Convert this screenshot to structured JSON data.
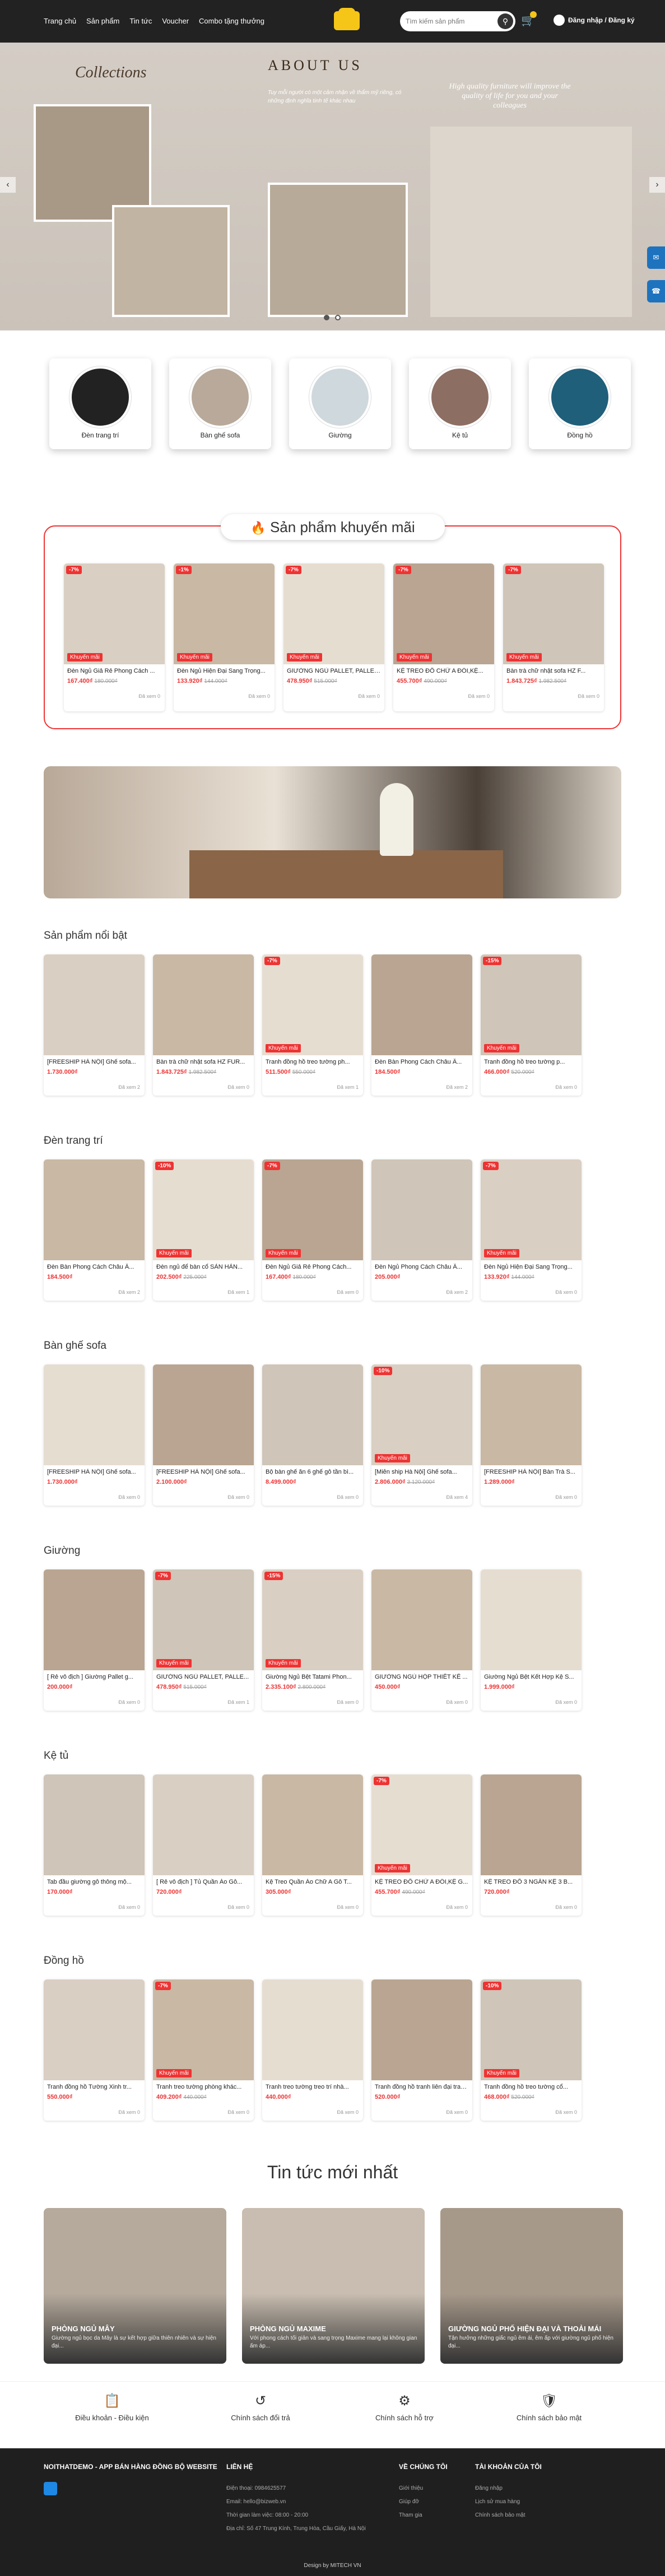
{
  "nav": [
    "Trang chủ",
    "Sản phẩm",
    "Tin tức",
    "Voucher",
    "Combo tặng thưởng"
  ],
  "search": {
    "placeholder": "Tìm kiếm sản phẩm"
  },
  "login": "Đăng nhập / Đăng ký",
  "hero": {
    "collections": "Collections",
    "about": "ABOUT US",
    "about_text": "Tuy mỗi người có một cảm nhận về thẩm mỹ riêng, có những định nghĩa tinh tế khác nhau",
    "quote": "High quality furniture will improve the quality of life for you and your colleagues"
  },
  "categories": [
    "Đèn trang trí",
    "Bàn ghế sofa",
    "Giường",
    "Kệ tủ",
    "Đồng hồ"
  ],
  "promo_title": "Sản phẩm khuyến mãi",
  "promo": [
    {
      "d": "-7%",
      "n": "Đèn Ngủ Giả Rẻ Phong Cách ...",
      "p": "167.400₫",
      "o": "180.000₫",
      "s": "Đã xem 0"
    },
    {
      "d": "-1%",
      "n": "Đèn Ngủ Hiện Đại Sang Trọng...",
      "p": "133.920₫",
      "o": "144.000₫",
      "s": "Đã xem 0"
    },
    {
      "d": "-7%",
      "n": "GIƯỜNG NGỦ PALLET, PALLET...",
      "p": "478.950₫",
      "o": "515.000₫",
      "s": "Đã xem 0"
    },
    {
      "d": "-7%",
      "n": "KỆ TREO ĐỒ CHỮ A ĐÔI,KỆ...",
      "p": "455.700₫",
      "o": "490.000₫",
      "s": "Đã xem 0"
    },
    {
      "d": "-7%",
      "n": "Bàn trà chữ nhật sofa HZ F...",
      "p": "1.843.725₫",
      "o": "1.982.500₫",
      "s": "Đã xem 0"
    }
  ],
  "sections": [
    {
      "title": "Sản phẩm nổi bật",
      "items": [
        {
          "d": "",
          "n": "[FREESHIP HÀ NỘI] Ghế sofa...",
          "p": "1.730.000₫",
          "o": "",
          "s": "Đã xem 2"
        },
        {
          "d": "",
          "n": "Bàn trà chữ nhật sofa HZ FUR...",
          "p": "1.843.725₫",
          "o": "1.982.500₫",
          "s": "Đã xem 0"
        },
        {
          "d": "-7%",
          "n": "Tranh đồng hồ treo tường ph...",
          "p": "511.500₫",
          "o": "550.000₫",
          "s": "Đã xem 1"
        },
        {
          "d": "",
          "n": "Đèn Bàn Phong Cách Châu Â...",
          "p": "184.500₫",
          "o": "",
          "s": "Đã xem 2"
        },
        {
          "d": "-15%",
          "n": "Tranh đồng hồ treo tường p...",
          "p": "466.000₫",
          "o": "520.000₫",
          "s": "Đã xem 0"
        }
      ]
    },
    {
      "title": "Đèn trang trí",
      "items": [
        {
          "d": "",
          "n": "Đèn Bàn Phong Cách Châu Â...",
          "p": "184.500₫",
          "o": "",
          "s": "Đã xem 2"
        },
        {
          "d": "-10%",
          "n": "Đèn ngủ để bàn cổ SẢN HẢN...",
          "p": "202.500₫",
          "o": "225.000₫",
          "s": "Đã xem 1"
        },
        {
          "d": "-7%",
          "n": "Đèn Ngủ Giả Rẻ Phong Cách...",
          "p": "167.400₫",
          "o": "180.000₫",
          "s": "Đã xem 0"
        },
        {
          "d": "",
          "n": "Đèn Ngủ Phong Cách Châu Â...",
          "p": "205.000₫",
          "o": "",
          "s": "Đã xem 2"
        },
        {
          "d": "-7%",
          "n": "Đèn Ngủ Hiện Đại Sang Trọng...",
          "p": "133.920₫",
          "o": "144.000₫",
          "s": "Đã xem 0"
        }
      ]
    },
    {
      "title": "Bàn ghế sofa",
      "items": [
        {
          "d": "",
          "n": "[FREESHIP HÀ NỘI] Ghế sofa...",
          "p": "1.730.000₫",
          "o": "",
          "s": "Đã xem 0"
        },
        {
          "d": "",
          "n": "[FREESHIP HÀ NỘI] Ghế sofa...",
          "p": "2.100.000₫",
          "o": "",
          "s": "Đã xem 0"
        },
        {
          "d": "",
          "n": "Bộ bàn ghế ăn 6 ghế gỗ tần bì...",
          "p": "8.499.000₫",
          "o": "",
          "s": "Đã xem 0"
        },
        {
          "d": "-10%",
          "n": "[Miễn ship Hà Nội] Ghế sofa...",
          "p": "2.806.000₫",
          "o": "3.120.000₫",
          "s": "Đã xem 4"
        },
        {
          "d": "",
          "n": "[FREESHIP HÀ NỘI] Bàn Trà S...",
          "p": "1.289.000₫",
          "o": "",
          "s": "Đã xem 0"
        }
      ]
    },
    {
      "title": "Giường",
      "items": [
        {
          "d": "",
          "n": "[ Rẻ vô địch ] Giường Pallet g...",
          "p": "200.000₫",
          "o": "",
          "s": "Đã xem 0"
        },
        {
          "d": "-7%",
          "n": "GIƯỜNG NGỦ PALLET, PALLE...",
          "p": "478.950₫",
          "o": "515.000₫",
          "s": "Đã xem 1"
        },
        {
          "d": "-15%",
          "n": "Giường Ngủ Bệt Tatami Phon...",
          "p": "2.335.100₫",
          "o": "2.800.000₫",
          "s": "Đã xem 0"
        },
        {
          "d": "",
          "n": "GIƯỜNG NGỦ HỘP THIẾT KẾ ...",
          "p": "450.000₫",
          "o": "",
          "s": "Đã xem 0"
        },
        {
          "d": "",
          "n": "Giường Ngủ Bệt Kết Hợp Kệ S...",
          "p": "1.999.000₫",
          "o": "",
          "s": "Đã xem 0"
        }
      ]
    },
    {
      "title": "Kệ tủ",
      "items": [
        {
          "d": "",
          "n": "Tab đầu giường gỗ thông mộ...",
          "p": "170.000₫",
          "o": "",
          "s": "Đã xem 0"
        },
        {
          "d": "",
          "n": "[ Rẻ vô địch ] Tủ Quần Áo Gỗ...",
          "p": "720.000₫",
          "o": "",
          "s": "Đã xem 0"
        },
        {
          "d": "",
          "n": "Kệ Treo Quần Áo Chữ A Gỗ T...",
          "p": "305.000₫",
          "o": "",
          "s": "Đã xem 0"
        },
        {
          "d": "-7%",
          "n": "KỆ TREO ĐỒ CHỮ A ĐÔI,KỆ G...",
          "p": "455.700₫",
          "o": "490.000₫",
          "s": "Đã xem 0"
        },
        {
          "d": "",
          "n": "KỆ TREO ĐỒ 3 NGĂN KỆ 3 B...",
          "p": "720.000₫",
          "o": "",
          "s": "Đã xem 0"
        }
      ]
    },
    {
      "title": "Đồng hồ",
      "items": [
        {
          "d": "",
          "n": "Tranh đồng hồ Tường Xinh tr...",
          "p": "550.000₫",
          "o": "",
          "s": "Đã xem 0"
        },
        {
          "d": "-7%",
          "n": "Tranh treo tường phòng khác...",
          "p": "409.200₫",
          "o": "440.000₫",
          "s": "Đã xem 0"
        },
        {
          "d": "",
          "n": "Tranh treo tường treo trí nhà...",
          "p": "440.000₫",
          "o": "",
          "s": "Đã xem 0"
        },
        {
          "d": "",
          "n": "Tranh đồng hồ tranh liên đại trang t...",
          "p": "520.000₫",
          "o": "",
          "s": "Đã xem 0"
        },
        {
          "d": "-10%",
          "n": "Tranh đồng hồ treo tường cổ...",
          "p": "468.000₫",
          "o": "520.000₫",
          "s": "Đã xem 0"
        }
      ]
    }
  ],
  "sale_label": "Khuyến mãi",
  "news_title": "Tin tức mới nhất",
  "news": [
    {
      "t": "PHÒNG NGỦ MÂY",
      "d": "Giường ngủ bọc da Mây là sự kết hợp giữa thiên nhiên và sự hiện đại..."
    },
    {
      "t": "PHÒNG NGỦ MAXIME",
      "d": "Với phong cách tối giản và sang trọng Maxime mang lại không gian ấm áp..."
    },
    {
      "t": "GIƯỜNG NGỦ PHỐ HIỆN ĐẠI VÀ THOẢI MÁI",
      "d": "Tận hưởng những giấc ngủ êm ái, êm ấp với giường ngủ phố hiện đại..."
    }
  ],
  "policies": [
    "Điều khoản - Điều kiện",
    "Chính sách đổi trả",
    "Chính sách hỗ trợ",
    "Chính sách bảo mật"
  ],
  "footer": {
    "brand": "NOITHATDEMO - APP BÁN HÀNG ĐỒNG BỘ WEBSITE",
    "contact_h": "LIÊN HỆ",
    "contact": [
      "Điện thoại: 0984625577",
      "Email: hello@bizweb.vn",
      "Thời gian làm việc: 08:00 - 20:00",
      "Địa chỉ: Số 47 Trung Kính, Trung Hòa, Cầu Giấy, Hà Nội"
    ],
    "about_h": "VỀ CHÚNG TÔI",
    "about": [
      "Giới thiệu",
      "Giúp đỡ",
      "Tham gia"
    ],
    "acc_h": "TÀI KHOẢN CỦA TÔI",
    "acc": [
      "Đăng nhập",
      "Lịch sử mua hàng",
      "Chính sách bảo mật"
    ],
    "credit": "Design by MITECH VN"
  }
}
